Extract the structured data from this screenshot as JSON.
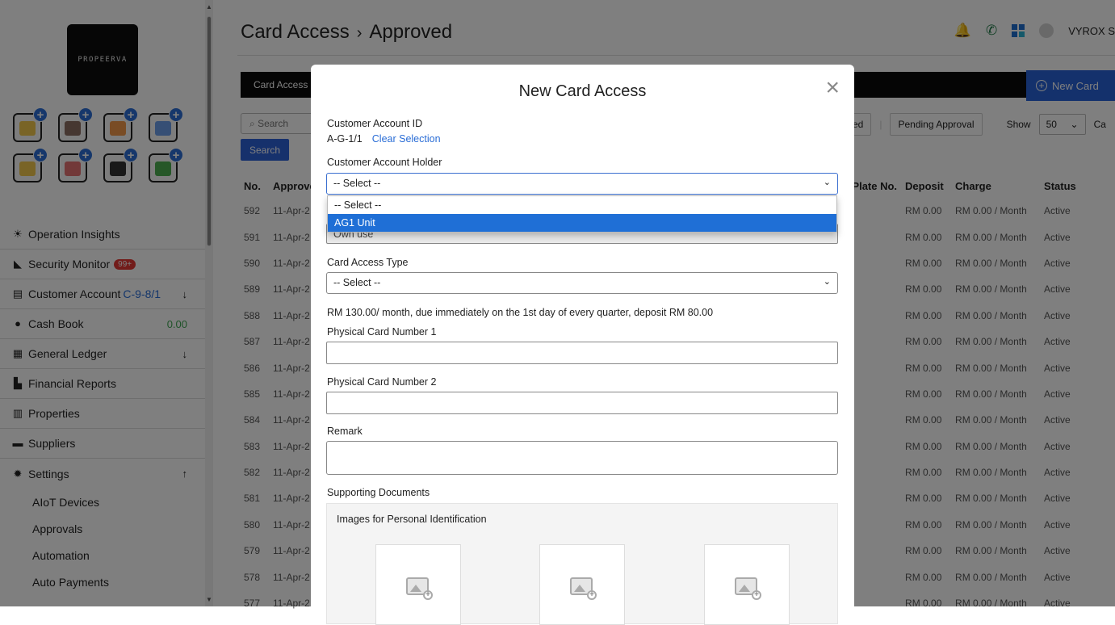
{
  "brand": {
    "logo_text": "PROPEERVA"
  },
  "quick_actions": [
    {
      "icon": "id-badge-icon",
      "color": "#f2c94c"
    },
    {
      "icon": "calendar-icon",
      "color": "#8d6e63"
    },
    {
      "icon": "bank-payment-icon",
      "color": "#f2994a"
    },
    {
      "icon": "bill-coins-icon",
      "color": "#6d9eeb"
    },
    {
      "icon": "access-card-icon",
      "color": "#f2c94c"
    },
    {
      "icon": "visitor-icon",
      "color": "#e57373"
    },
    {
      "icon": "vehicle-plate-icon",
      "color": "#333333"
    },
    {
      "icon": "login-account-icon",
      "color": "#4caf50"
    }
  ],
  "nav": {
    "operation_insights": "Operation Insights",
    "security_monitor": "Security Monitor",
    "security_badge": "99+",
    "customer_account": "Customer Account",
    "customer_account_ref": "C-9-8/1",
    "down_arrow": "↓",
    "up_arrow": "↑",
    "cash_book": "Cash Book",
    "cash_amount": "0.00",
    "general_ledger": "General Ledger",
    "financial_reports": "Financial Reports",
    "properties": "Properties",
    "suppliers": "Suppliers",
    "settings": "Settings",
    "settings_sub": [
      "AIoT Devices",
      "Approvals",
      "Automation",
      "Auto Payments"
    ]
  },
  "header": {
    "title": "Card Access",
    "separator": "›",
    "subtitle": "Approved",
    "user": "VYROX S"
  },
  "toolbar": {
    "tab_label": "Card Access",
    "new_button": "New Card",
    "search_placeholder": "Search",
    "search_button": "Search",
    "filter_partial": "ed",
    "pending_approval": "Pending Approval",
    "show_label": "Show",
    "show_value": "50",
    "trailing_partial": "Ca"
  },
  "table": {
    "headers": {
      "no": "No.",
      "approved": "Approve",
      "plate": "cle Plate No.",
      "deposit": "Deposit",
      "charge": "Charge",
      "status": "Status"
    },
    "rows": [
      {
        "no": "592",
        "date": "11-Apr-2",
        "deposit": "RM 0.00",
        "charge": "RM 0.00 / Month",
        "status": "Active"
      },
      {
        "no": "591",
        "date": "11-Apr-2",
        "deposit": "RM 0.00",
        "charge": "RM 0.00 / Month",
        "status": "Active"
      },
      {
        "no": "590",
        "date": "11-Apr-2",
        "deposit": "RM 0.00",
        "charge": "RM 0.00 / Month",
        "status": "Active"
      },
      {
        "no": "589",
        "date": "11-Apr-2",
        "deposit": "RM 0.00",
        "charge": "RM 0.00 / Month",
        "status": "Active"
      },
      {
        "no": "588",
        "date": "11-Apr-2",
        "deposit": "RM 0.00",
        "charge": "RM 0.00 / Month",
        "status": "Active"
      },
      {
        "no": "587",
        "date": "11-Apr-2",
        "deposit": "RM 0.00",
        "charge": "RM 0.00 / Month",
        "status": "Active"
      },
      {
        "no": "586",
        "date": "11-Apr-2",
        "deposit": "RM 0.00",
        "charge": "RM 0.00 / Month",
        "status": "Active"
      },
      {
        "no": "585",
        "date": "11-Apr-2",
        "deposit": "RM 0.00",
        "charge": "RM 0.00 / Month",
        "status": "Active"
      },
      {
        "no": "584",
        "date": "11-Apr-2",
        "deposit": "RM 0.00",
        "charge": "RM 0.00 / Month",
        "status": "Active"
      },
      {
        "no": "583",
        "date": "11-Apr-2",
        "deposit": "RM 0.00",
        "charge": "RM 0.00 / Month",
        "status": "Active"
      },
      {
        "no": "582",
        "date": "11-Apr-2",
        "deposit": "RM 0.00",
        "charge": "RM 0.00 / Month",
        "status": "Active"
      },
      {
        "no": "581",
        "date": "11-Apr-2",
        "deposit": "RM 0.00",
        "charge": "RM 0.00 / Month",
        "status": "Active"
      },
      {
        "no": "580",
        "date": "11-Apr-2",
        "deposit": "RM 0.00",
        "charge": "RM 0.00 / Month",
        "status": "Active"
      },
      {
        "no": "579",
        "date": "11-Apr-2",
        "deposit": "RM 0.00",
        "charge": "RM 0.00 / Month",
        "status": "Active"
      },
      {
        "no": "578",
        "date": "11-Apr-2",
        "deposit": "RM 0.00",
        "charge": "RM 0.00 / Month",
        "status": "Active"
      },
      {
        "no": "577",
        "date": "11-Apr-2",
        "deposit": "RM 0.00",
        "charge": "RM 0.00 / Month",
        "status": "Active"
      }
    ]
  },
  "modal": {
    "title": "New Card Access",
    "close": "×",
    "account_id_label": "Customer Account ID",
    "account_id_value": "A-G-1/1",
    "clear_selection": "Clear Selection",
    "holder_label": "Customer Account Holder",
    "holder_value": "-- Select --",
    "holder_options": [
      "-- Select --",
      "AG1 Unit"
    ],
    "usage_value": "Own use",
    "type_label": "Card Access Type",
    "type_value": "-- Select --",
    "fee_note": "RM 130.00/ month, due immediately on the 1st day of every quarter, deposit RM 80.00",
    "card1_label": "Physical Card Number 1",
    "card2_label": "Physical Card Number 2",
    "remark_label": "Remark",
    "docs_label": "Supporting Documents",
    "docs_sub": "Images for Personal Identification"
  }
}
